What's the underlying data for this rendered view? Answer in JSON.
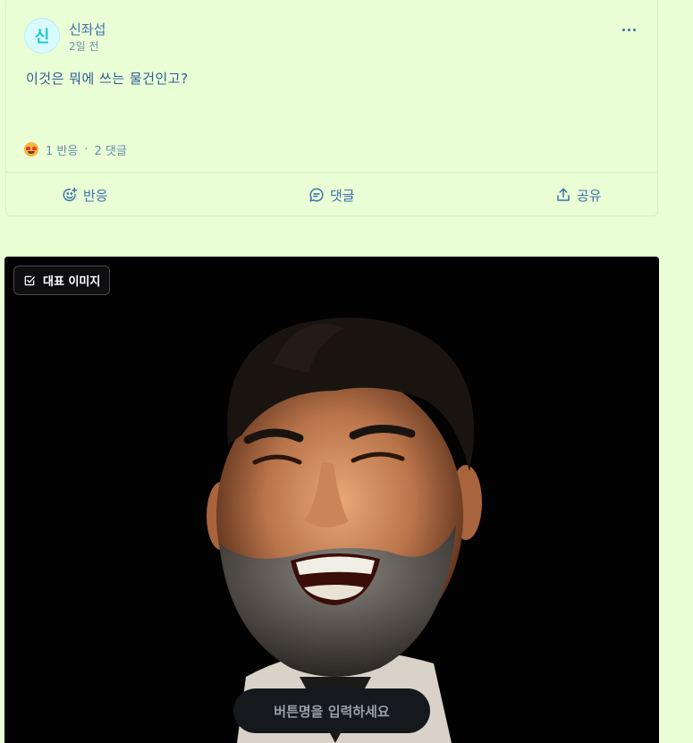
{
  "post": {
    "avatar_initial": "신",
    "author": "신좌섭",
    "time": "2일 전",
    "body": "이것은 뭐에 쓰는 물건인고?",
    "stats": {
      "reaction_count": "1 반응",
      "separator": "·",
      "comment_count": "2 댓글"
    },
    "actions": {
      "react": "반응",
      "comment": "댓글",
      "share": "공유"
    }
  },
  "image": {
    "badge_label": "대표 이미지",
    "button_placeholder": "버튼명을 입력하세요"
  },
  "colors": {
    "background": "#eaffd6",
    "accent": "#3b6fae",
    "avatar_bg": "#d9fbff",
    "avatar_text": "#1fc3d8"
  },
  "icons": [
    "more-icon",
    "emoji-heart-eyes-icon",
    "add-reaction-icon",
    "comment-icon",
    "share-icon",
    "checkbox-icon"
  ]
}
